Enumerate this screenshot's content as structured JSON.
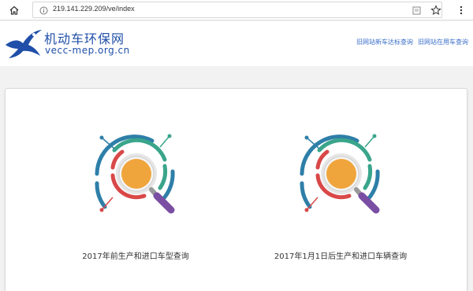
{
  "browser": {
    "url": "219.141.229.209/ve/index",
    "home_icon": "home-icon",
    "info_icon": "info-icon",
    "reader_icon": "reader-mode-icon",
    "star_icon": "star-icon",
    "more_icon": "more-icon"
  },
  "site": {
    "logo_cn": "机动车环保网",
    "logo_en": "vecc-mep.org.cn",
    "nav": [
      {
        "label": "旧网站新车达标查询"
      },
      {
        "label": "旧网站在用车查询"
      }
    ]
  },
  "queries": [
    {
      "label": "2017年前生产和进口车型查询",
      "icon": "magnifier-icon"
    },
    {
      "label": "2017年1月1日后生产和进口车辆查询",
      "icon": "magnifier-icon"
    }
  ],
  "colors": {
    "brand": "#1f4fa8",
    "link": "#3a6fc9",
    "lens": "#f0a53c",
    "ring_teal": "#3aa58b",
    "ring_red": "#d94848",
    "ring_blue": "#2e7fa8",
    "handle": "#7a4fa3"
  }
}
